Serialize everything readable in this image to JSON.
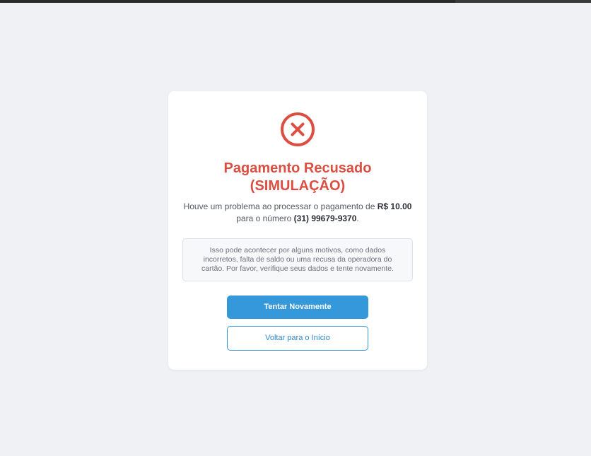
{
  "browser": {
    "loading_progress": 0.77
  },
  "result": {
    "status_icon": "x-circle-icon",
    "title_line1": "Pagamento Recusado",
    "title_line2": "(SIMULAÇÃO)",
    "message_prefix": "Houve um problema ao processar o pagamento de ",
    "amount": "R$ 10.00",
    "message_middle": "para o número ",
    "phone": "(31) 99679-9370",
    "message_suffix": ".",
    "info_text": "Isso pode acontecer por alguns motivos, como dados incorretos, falta de saldo ou uma recusa da operadora do cartão. Por favor, verifique seus dados e tente novamente."
  },
  "actions": {
    "retry_label": "Tentar Novamente",
    "back_label": "Voltar para o Início"
  },
  "colors": {
    "error": "#dc4e41",
    "primary": "#3498db",
    "background": "#f0f1f5"
  }
}
